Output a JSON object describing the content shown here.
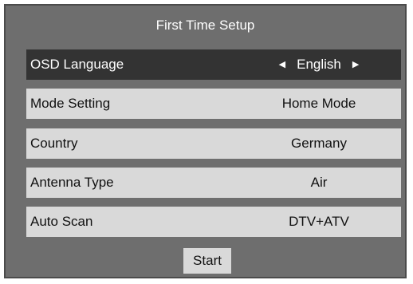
{
  "title": "First Time Setup",
  "rows": [
    {
      "label": "OSD Language",
      "value": "English",
      "left_arrow": "◀",
      "right_arrow": "▶"
    },
    {
      "label": "Mode Setting",
      "value": "Home Mode"
    },
    {
      "label": "Country",
      "value": "Germany"
    },
    {
      "label": "Antenna Type",
      "value": "Air"
    },
    {
      "label": "Auto Scan",
      "value": "DTV+ATV"
    }
  ],
  "start_label": "Start",
  "colors": {
    "panel": "#6e6e6e",
    "row": "#d9d9d9",
    "selected_row": "#333333"
  },
  "icons": [
    "triangle-left-icon",
    "triangle-right-icon"
  ]
}
